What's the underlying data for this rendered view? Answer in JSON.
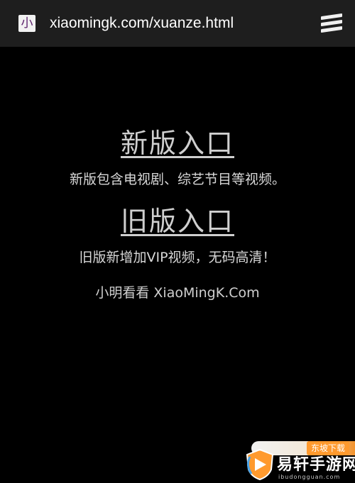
{
  "browser": {
    "site_icon_glyph": "小",
    "url": "xiaomingk.com/xuanze.html",
    "menu_icon": "hamburger-menu-icon"
  },
  "main": {
    "new_entry": {
      "label": "新版入口",
      "description": "新版包含电视剧、综艺节目等视频。"
    },
    "old_entry": {
      "label": "旧版入口",
      "description": "旧版新增加VIP视频，无码高清！"
    },
    "footer": "小明看看 XiaoMingK.Com"
  },
  "watermark": {
    "badge": "东坡下载",
    "brand": "易轩手游网",
    "domain": "ibudongguan.com"
  },
  "colors": {
    "background": "#000000",
    "topbar": "#1e1e1e",
    "text": "#d6d6d6",
    "watermark_orange": "#ff9a2e"
  }
}
